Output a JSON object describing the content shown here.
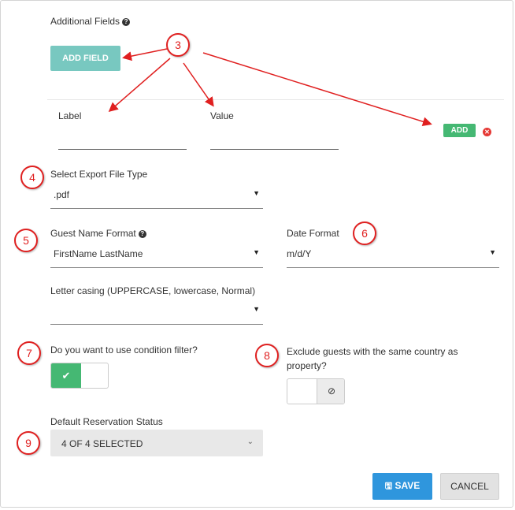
{
  "additional_fields": {
    "title": "Additional Fields",
    "help_icon": "question-circle-icon",
    "add_field_label": "ADD FIELD",
    "label_header": "Label",
    "value_header": "Value",
    "label_value": "",
    "value_value": "",
    "add_label": "ADD",
    "remove_icon": "close-circle-icon"
  },
  "export": {
    "label": "Select Export File Type",
    "value": ".pdf"
  },
  "guest_name": {
    "label": "Guest Name Format",
    "value": "FirstName LastName"
  },
  "date_format": {
    "label": "Date Format",
    "value": "m/d/Y"
  },
  "letter_casing": {
    "label": "Letter casing (UPPERCASE, lowercase, Normal)",
    "value": ""
  },
  "condition_filter": {
    "label": "Do you want to use condition filter?",
    "on": true
  },
  "exclude_guests": {
    "label_line1": "Exclude guests with the same country as",
    "label_line2": "property?",
    "on": false
  },
  "reservation_status": {
    "label": "Default Reservation Status",
    "value": "4 OF 4 SELECTED"
  },
  "footer": {
    "save_label": "SAVE",
    "cancel_label": "CANCEL"
  },
  "annotations": [
    "3",
    "4",
    "5",
    "6",
    "7",
    "8",
    "9"
  ],
  "colors": {
    "annotation_red": "#e02020",
    "teal": "#78c8c0",
    "green": "#45b873",
    "blue": "#2f96dd"
  }
}
